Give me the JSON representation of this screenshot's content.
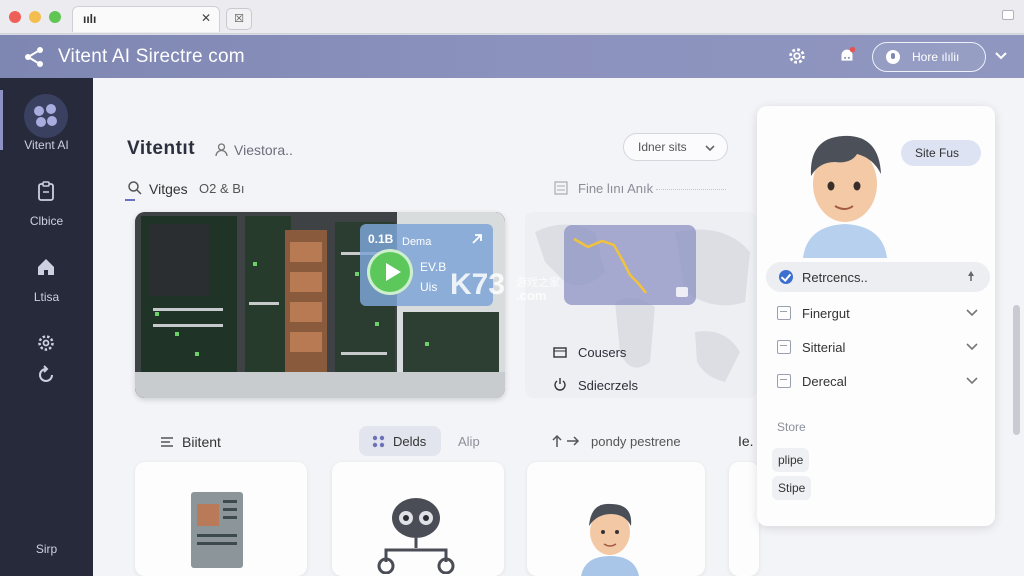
{
  "browser": {
    "tab_title": "ıılı",
    "tab_close": "✕",
    "new_tab": "☒"
  },
  "header": {
    "title": "Vitent AI Sirectre com",
    "user_button": "Hore ılıliı"
  },
  "sidebar": {
    "items": [
      {
        "label": "Vitent AI",
        "icon": "logo-icon"
      },
      {
        "label": "Clbice",
        "icon": "clipboard-icon"
      },
      {
        "label": "Ltisa",
        "icon": "home-icon"
      },
      {
        "label": "",
        "icon": "gear-icon"
      },
      {
        "label": "",
        "icon": "refresh-icon"
      }
    ],
    "bottom_label": "Sirp"
  },
  "main": {
    "title": "Vitentıt",
    "subtitle": "Viestora..",
    "filter_label": "Idner sits",
    "section_label": "Vitges",
    "section_extra": "O2 & Bı",
    "find_label": "Fine lını Anık",
    "overlay": {
      "line1": "0.1B",
      "line2": "Dema",
      "line3": "EV.B",
      "line4": "Uis"
    },
    "map_options": [
      "Cousers",
      "Sdiecrzels"
    ],
    "tabs_label": "Biitent",
    "segment_active": "Delds",
    "segment_other": "Alip",
    "sort_label": "pondy pestrene",
    "cut_label": "Ie."
  },
  "right_panel": {
    "bubble": "Site Fus",
    "items": [
      {
        "label": "Retrcencs..",
        "active": true
      },
      {
        "label": "Finergut",
        "active": false
      },
      {
        "label": "Sitterial",
        "active": false
      },
      {
        "label": "Derecal",
        "active": false
      }
    ],
    "store_label": "Store",
    "chips": [
      "plipe",
      "Stipe"
    ]
  },
  "watermark": {
    "brand": "K73",
    "sub": "游戏之家",
    "domain": ".com"
  },
  "colors": {
    "header": "#8a91bc",
    "sidebar": "#262a3a",
    "accent": "#3c6fd0",
    "play": "#5cc85c"
  }
}
